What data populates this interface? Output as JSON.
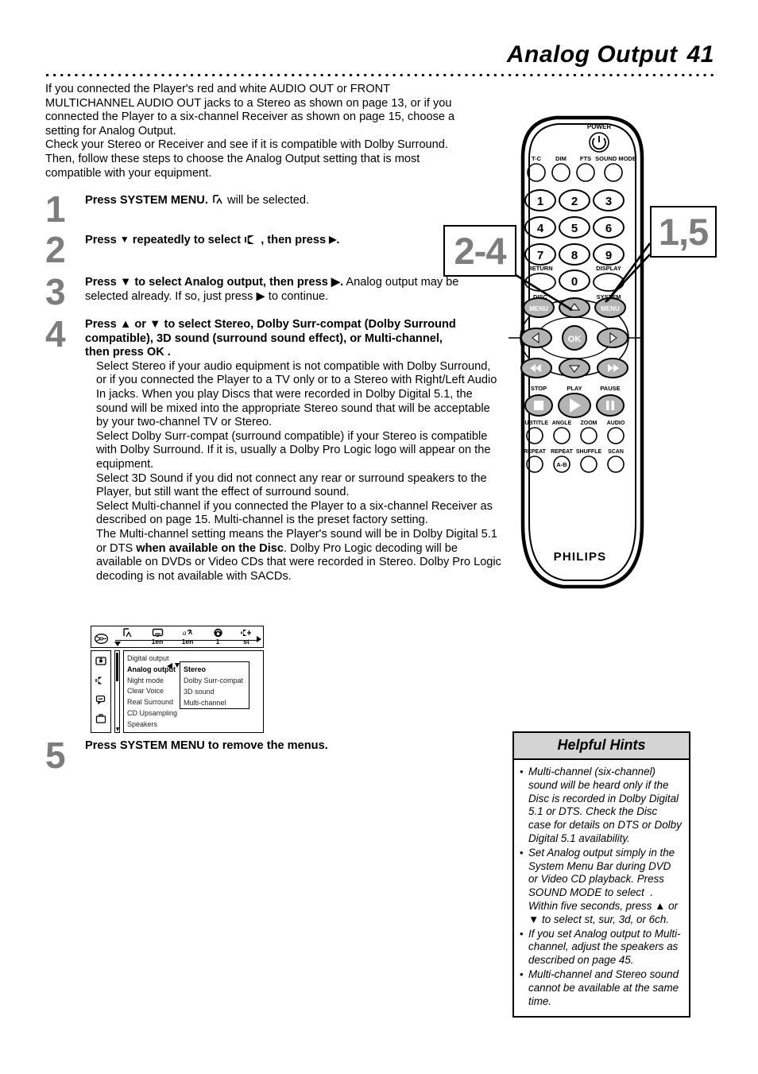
{
  "header": {
    "title": "Analog Output",
    "page_number": "41"
  },
  "intro": {
    "lines": [
      "If you connected the Player's red and white AUDIO OUT or FRONT",
      "MULTICHANNEL AUDIO OUT jacks to a Stereo as shown on page 13, or if you",
      "connected the Player to a six-channel Receiver as shown on page 15, choose a",
      "setting for Analog Output.",
      "Check your Stereo or Receiver and see if it is compatible with Dolby Surround.",
      "Then, follow these steps to choose the Analog Output setting that is most",
      "compatible with your equipment."
    ]
  },
  "steps": {
    "one": {
      "number": "1",
      "bold": "Press SYSTEM MENU.",
      "icon": "playback-tilt-icon",
      "rest": "will be selected."
    },
    "two": {
      "number": "2",
      "bold_a": "Press",
      "bold_b": "repeatedly to select",
      "icon": "speaker-icon",
      "bold_c": ", then press",
      "down_arrow": "▼",
      "right_arrow": "▶"
    },
    "three": {
      "number": "3",
      "bold": "Press ▼ to select Analog output, then press ▶.",
      "rest_line1": "Analog output",
      "rest_line2": "may be selected already. If so, just press ▶ to continue."
    },
    "four": {
      "number": "4",
      "bold_lines": [
        "Press ▲ or ▼ to select Stereo, Dolby Surr-compat (Dolby Surround",
        "compatible), 3D sound (surround sound effect), or Multi-channel,",
        "then press OK ."
      ],
      "paragraphs": [
        "Select Stereo if your audio equipment is not compatible with Dolby Surround, or if you connected the Player to a TV only or to a Stereo with Right/Left Audio In jacks. When you play Discs that were recorded in Dolby Digital 5.1, the sound will be mixed into the appropriate Stereo sound that will be acceptable by your two-channel TV or Stereo.",
        "Select Dolby Surr-compat (surround compatible) if your Stereo is compatible with Dolby Surround. If it is, usually a Dolby Pro Logic logo will appear on the equipment.",
        "Select 3D Sound if you did not connect any rear or surround speakers to the Player, but still want the effect of surround sound.",
        "Select Multi-channel if you connected the Player to a six-channel Receiver as described on page 15. Multi-channel is the preset factory setting."
      ],
      "last_paragraph": {
        "a": "The Multi-channel setting means the Player's sound will be in Dolby Digital 5.1 or DTS ",
        "bold": "when available on the Disc",
        "b": ". Dolby Pro Logic decoding will be available on DVDs or Video CDs that were recorded in Stereo. Dolby Pro Logic decoding is not available with SACDs."
      }
    },
    "five": {
      "number": "5",
      "bold": "Press SYSTEM MENU to remove the menus."
    }
  },
  "osd": {
    "menu_bar": {
      "disc_icon": "disc-icon",
      "cells": [
        {
          "icon": "title-chapter-icon",
          "value": ""
        },
        {
          "icon": "subtitle-icon",
          "value": "1en"
        },
        {
          "icon": "audio-language-icon",
          "value": "1en"
        },
        {
          "icon": "angle-icon",
          "value": "1"
        },
        {
          "icon": "sound-mode-icon",
          "value": "st"
        }
      ]
    },
    "sidebar_icons": [
      "picture-icon",
      "sound-icon",
      "language-icon",
      "features-icon"
    ],
    "menu_items": [
      {
        "label": "Digital output",
        "selected": false
      },
      {
        "label": "Analog output",
        "selected": true
      },
      {
        "label": "Night mode",
        "selected": false
      },
      {
        "label": "Clear Voice",
        "selected": false
      },
      {
        "label": "Real Surround",
        "selected": false
      },
      {
        "label": "CD Upsampling",
        "selected": false
      },
      {
        "label": "Speakers",
        "selected": false
      }
    ],
    "submenu_items": [
      {
        "label": "Stereo",
        "selected": true
      },
      {
        "label": "Dolby Surr-compat",
        "selected": false
      },
      {
        "label": "3D sound",
        "selected": false
      },
      {
        "label": "Multi-channel",
        "selected": false
      }
    ]
  },
  "remote": {
    "brand": "PHILIPS",
    "power_label": "POWER",
    "row_top": [
      "T-C",
      "DIM",
      "FTS",
      "SOUND MODE"
    ],
    "keypad": [
      "1",
      "2",
      "3",
      "4",
      "5",
      "6",
      "7",
      "8",
      "9",
      "0"
    ],
    "return_label": "RETURN",
    "display_label": "DISPLAY",
    "disc_label": "DISC",
    "system_label": "SYSTEM",
    "menu_label_disc": "MENU",
    "menu_label_system": "MENU",
    "ok_label": "OK",
    "transport_labels": [
      "STOP",
      "PLAY",
      "PAUSE"
    ],
    "row_subtitle": [
      "SUBTITLE",
      "ANGLE",
      "ZOOM",
      "AUDIO"
    ],
    "row_repeat": [
      "REPEAT",
      "REPEAT",
      "SHUFFLE",
      "SCAN"
    ],
    "repeat_ab": "A-B"
  },
  "callouts": {
    "left": "2-4",
    "right": "1,5"
  },
  "hints": {
    "title": "Helpful Hints",
    "bullet": "•",
    "items": [
      "Multi-channel (six-channel) sound will be heard only if the Disc is recorded in Dolby Digital 5.1 or DTS. Check the Disc case for details on DTS or Dolby Digital 5.1 availability.",
      "Set Analog output simply in the System Menu Bar during DVD or Video CD playback. Press SOUND MODE to select  . Within five seconds, press ▲ or ▼ to select st, sur, 3d, or 6ch.",
      "If you set Analog output to Multi-channel, adjust the speakers as described on page 45.",
      "Multi-channel and Stereo sound cannot be available at the same time."
    ]
  },
  "colors": {
    "step_number": "#7d7d7d",
    "hints_header_bg": "#d4d4d4",
    "button_fill": "#b3b3b3"
  }
}
